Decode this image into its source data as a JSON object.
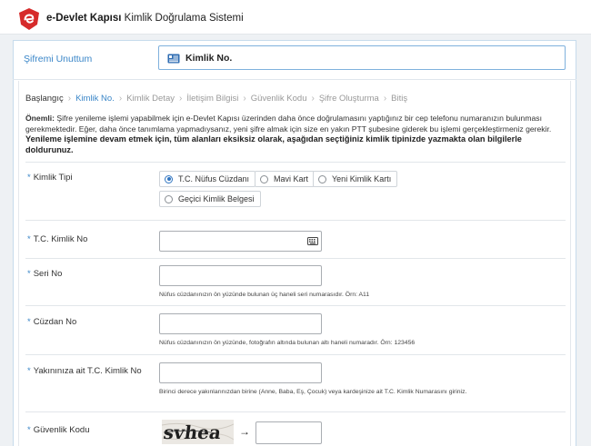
{
  "header": {
    "brand_bold": "e-Devlet Kapısı",
    "brand_rest": "Kimlik Doğrulama Sistemi",
    "accent": "#d62b2b"
  },
  "method": {
    "label": "Şifremi Unuttum",
    "selected": "Kimlik No.",
    "icon": "id-card-icon"
  },
  "steps": [
    {
      "label": "Başlangıç",
      "state": "done"
    },
    {
      "label": "Kimlik No.",
      "state": "active"
    },
    {
      "label": "Kimlik Detay",
      "state": "pending"
    },
    {
      "label": "İletişim Bilgisi",
      "state": "pending"
    },
    {
      "label": "Güvenlik Kodu",
      "state": "pending"
    },
    {
      "label": "Şifre Oluşturma",
      "state": "pending"
    },
    {
      "label": "Bitiş",
      "state": "pending"
    }
  ],
  "notice": {
    "label": "Önemli:",
    "text": " Şifre yenileme işlemi yapabilmek için e-Devlet Kapısı üzerinden daha önce doğrulamasını yaptığınız bir cep telefonu numaranızın bulunması gerekmektedir. Eğer, daha önce tanımlama yapmadıysanız, yeni şifre almak için size en yakın PTT şubesine giderek bu işlemi gerçekleştirmeniz gerekir.",
    "strong": "Yenileme işlemine devam etmek için, tüm alanları eksiksiz olarak, aşağıdan seçtiğiniz kimlik tipinizde yazmakta olan bilgilerle doldurunuz."
  },
  "form": {
    "required_mark": "*",
    "kimlik_tipi": {
      "label": "Kimlik Tipi",
      "options": [
        "T.C. Nüfus Cüzdanı",
        "Mavi Kart",
        "Yeni Kimlik Kartı",
        "Geçici Kimlik Belgesi"
      ],
      "selected": "T.C. Nüfus Cüzdanı"
    },
    "tc_kimlik_no": {
      "label": "T.C. Kimlik No",
      "value": "",
      "icon": "keyboard-icon"
    },
    "seri_no": {
      "label": "Seri No",
      "value": "",
      "help": "Nüfus cüzdanınızın ön yüzünde bulunan üç haneli seri numarasıdır. Örn: A11"
    },
    "cuzdan_no": {
      "label": "Cüzdan No",
      "value": "",
      "help": "Nüfus cüzdanınızın ön yüzünde, fotoğrafın altında bulunan altı haneli numaradır. Örn: 123456"
    },
    "yakin_tc": {
      "label": "Yakınınıza ait T.C. Kimlik No",
      "value": "",
      "help": "Birinci derece yakınlarınızdan birine (Anne, Baba, Eş, Çocuk) veya kardeşinize ait T.C. Kimlik Numarasını giriniz."
    },
    "guvenlik_kodu": {
      "label": "Güvenlik Kodu",
      "captcha_text": "svhea",
      "arrow": "→",
      "value": ""
    }
  }
}
